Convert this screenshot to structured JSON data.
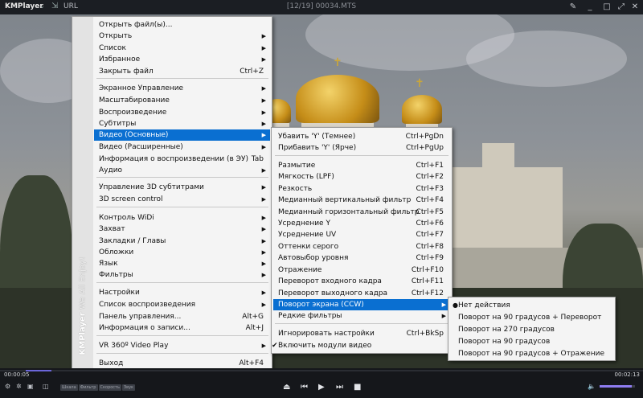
{
  "titlebar": {
    "logo": "KMPlayer",
    "url_label": "URL",
    "file_title": "[12/19] 00034.MTS",
    "icons": [
      "pin-icon",
      "minimize-icon",
      "maximize-icon",
      "fullscreen-icon",
      "close-icon"
    ]
  },
  "main_menu": {
    "items": [
      {
        "label": "Открыть файл(ы)...",
        "shortcut": "",
        "arrow": false
      },
      {
        "label": "Открыть",
        "shortcut": "",
        "arrow": true
      },
      {
        "label": "Список",
        "shortcut": "",
        "arrow": true
      },
      {
        "label": "Избранное",
        "shortcut": "",
        "arrow": true
      },
      {
        "label": "Закрыть файл",
        "shortcut": "Ctrl+Z",
        "arrow": false
      },
      {
        "label": "Экранное Управление",
        "shortcut": "",
        "arrow": true
      },
      {
        "label": "Масштабирование",
        "shortcut": "",
        "arrow": true
      },
      {
        "label": "Воспроизведение",
        "shortcut": "",
        "arrow": true
      },
      {
        "label": "Субтитры",
        "shortcut": "",
        "arrow": true
      },
      {
        "label": "Видео (Основные)",
        "shortcut": "",
        "arrow": true
      },
      {
        "label": "Видео (Расширенные)",
        "shortcut": "",
        "arrow": true
      },
      {
        "label": "Информация о воспроизведении (в ЭУ)",
        "shortcut": "Tab",
        "arrow": false
      },
      {
        "label": "Аудио",
        "shortcut": "",
        "arrow": true
      },
      {
        "label": "Управление 3D субтитрами",
        "shortcut": "",
        "arrow": true
      },
      {
        "label": "3D screen control",
        "shortcut": "",
        "arrow": true
      },
      {
        "label": "Контроль WiDi",
        "shortcut": "",
        "arrow": true
      },
      {
        "label": "Захват",
        "shortcut": "",
        "arrow": true
      },
      {
        "label": "Закладки / Главы",
        "shortcut": "",
        "arrow": true
      },
      {
        "label": "Обложки",
        "shortcut": "",
        "arrow": true
      },
      {
        "label": "Язык",
        "shortcut": "",
        "arrow": true
      },
      {
        "label": "Фильтры",
        "shortcut": "",
        "arrow": true
      },
      {
        "label": "Настройки",
        "shortcut": "",
        "arrow": true
      },
      {
        "label": "Список воспроизведения",
        "shortcut": "",
        "arrow": true
      },
      {
        "label": "Панель управления...",
        "shortcut": "Alt+G",
        "arrow": false
      },
      {
        "label": "Информация о записи...",
        "shortcut": "Alt+J",
        "arrow": false
      },
      {
        "label": "VR 360º Video Play",
        "shortcut": "",
        "arrow": true
      },
      {
        "label": "Выход",
        "shortcut": "Alt+F4",
        "arrow": false
      }
    ],
    "side_brand": "KMPlayer",
    "side_slogan": "We All Enjoy!"
  },
  "video_menu": {
    "items": [
      {
        "label": "Убавить 'Y' (Темнее)",
        "shortcut": "Ctrl+PgDn"
      },
      {
        "label": "Прибавить 'Y' (Ярче)",
        "shortcut": "Ctrl+PgUp"
      },
      {
        "label": "Размытие",
        "shortcut": "Ctrl+F1"
      },
      {
        "label": "Мягкость (LPF)",
        "shortcut": "Ctrl+F2"
      },
      {
        "label": "Резкость",
        "shortcut": "Ctrl+F3"
      },
      {
        "label": "Медианный вертикальный фильтр",
        "shortcut": "Ctrl+F4"
      },
      {
        "label": "Медианный горизонтальный фильтр",
        "shortcut": "Ctrl+F5"
      },
      {
        "label": "Усреднение  Y",
        "shortcut": "Ctrl+F6"
      },
      {
        "label": "Усреднение  UV",
        "shortcut": "Ctrl+F7"
      },
      {
        "label": "Оттенки серого",
        "shortcut": "Ctrl+F8"
      },
      {
        "label": "Автовыбор уровня",
        "shortcut": "Ctrl+F9"
      },
      {
        "label": "Отражение",
        "shortcut": "Ctrl+F10"
      },
      {
        "label": "Переворот входного кадра",
        "shortcut": "Ctrl+F11"
      },
      {
        "label": "Переворот выходного кадра",
        "shortcut": "Ctrl+F12"
      },
      {
        "label": "Поворот экрана (CCW)",
        "shortcut": ""
      },
      {
        "label": "Редкие фильтры",
        "shortcut": ""
      },
      {
        "label": "Игнорировать настройки",
        "shortcut": "Ctrl+BkSp"
      },
      {
        "label": "Включить модули видео",
        "shortcut": ""
      }
    ]
  },
  "rotate_menu": {
    "items": [
      {
        "label": "Нет действия",
        "selected": true
      },
      {
        "label": "Поворот на 90 градусов + Переворот",
        "selected": false
      },
      {
        "label": "Поворот на 270 градусов",
        "selected": false
      },
      {
        "label": "Поворот на 90 градусов",
        "selected": false
      },
      {
        "label": "Поворот на 90 градусов + Отражение",
        "selected": false
      }
    ]
  },
  "controls": {
    "time_elapsed": "00:00:05",
    "time_total": "00:02:13",
    "progress": 0.04,
    "volume": 0.9,
    "badges": [
      "Шкала",
      "Фильтр",
      "Скорость",
      "Звук"
    ]
  },
  "colors": {
    "highlight": "#0a6fd1",
    "seek_fill": "#6b66d9",
    "volume_fill": "#8e7cf0"
  }
}
